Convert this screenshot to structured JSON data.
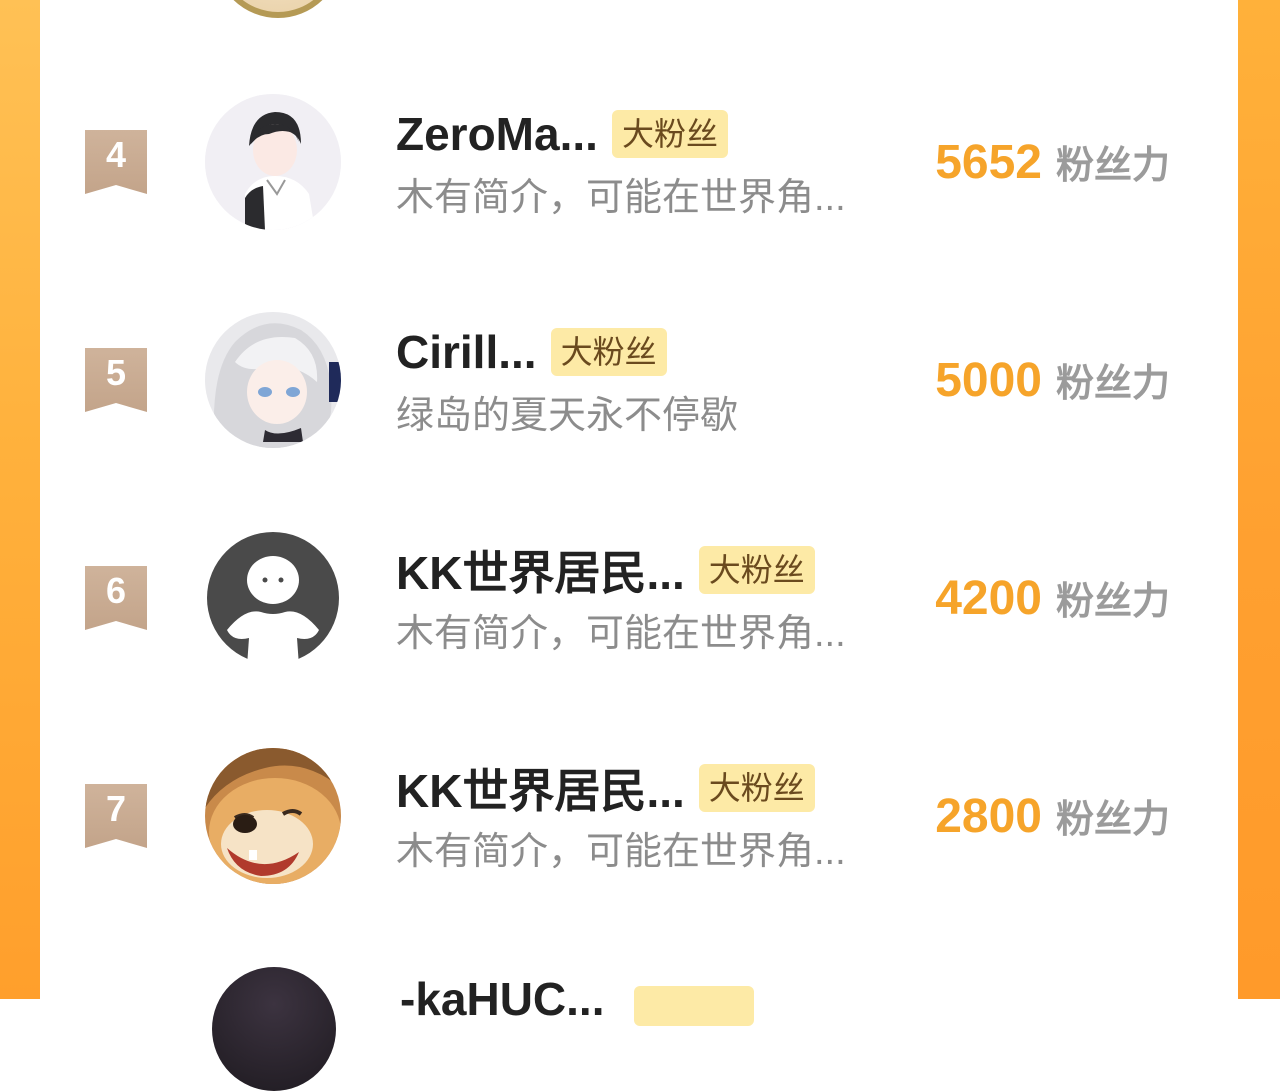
{
  "badge_label": "大粉丝",
  "score_unit": "粉丝力",
  "colors": {
    "accent_orange": "#f6a42a",
    "badge_bg": "#fdeaa6",
    "rank_flag": "#c6a98f",
    "side_gradient": "#ffb13c"
  },
  "ranking": [
    {
      "rank": "4",
      "name": "ZeroMa...",
      "bio": "木有简介，可能在世界角...",
      "score": "5652",
      "avatar": "anime-boy-avatar"
    },
    {
      "rank": "5",
      "name": "Cirill...",
      "bio": "绿岛的夏天永不停歇",
      "score": "5000",
      "avatar": "anime-girl-avatar"
    },
    {
      "rank": "6",
      "name": "KK世界居民...",
      "bio": "木有简介，可能在世界角...",
      "score": "4200",
      "avatar": "default-user-avatar"
    },
    {
      "rank": "7",
      "name": "KK世界居民...",
      "bio": "木有简介，可能在世界角...",
      "score": "2800",
      "avatar": "shiba-dog-avatar"
    }
  ],
  "partial_next": {
    "name": "-kaHUC..."
  }
}
